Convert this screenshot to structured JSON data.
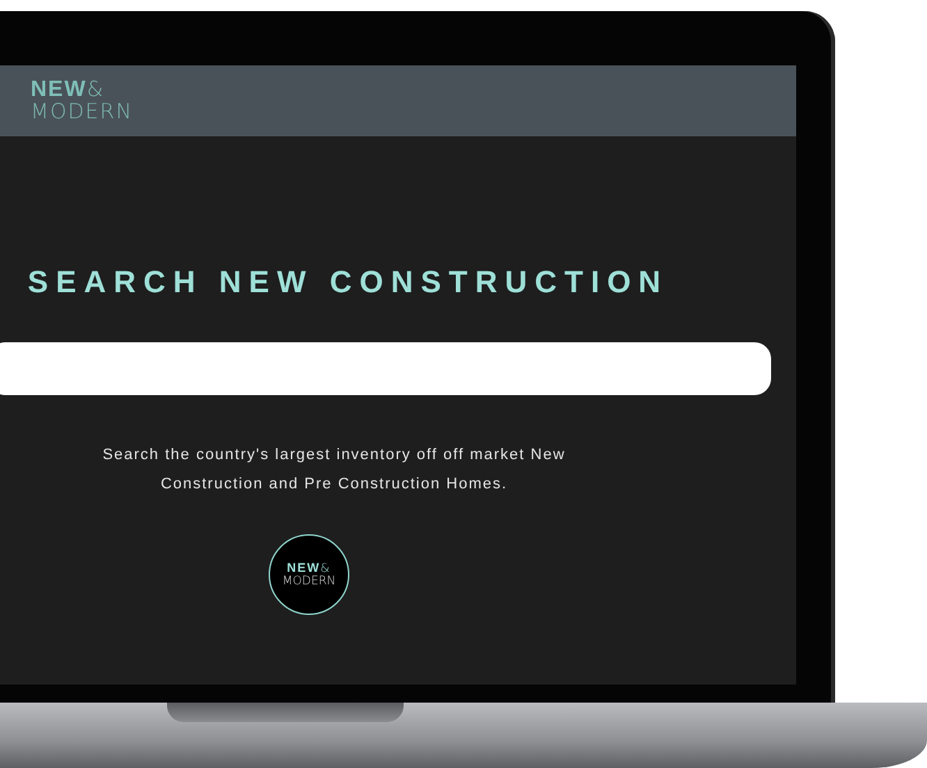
{
  "header": {
    "logo": {
      "word_1": "NEW",
      "symbol": "&",
      "word_2": "MODERN"
    }
  },
  "hero": {
    "title": "SEARCH NEW CONSTRUCTION",
    "description_lines": [
      "Search the country's largest inventory off off market New",
      "Construction and Pre Construction Homes."
    ]
  },
  "badge": {
    "word_1": "NEW",
    "symbol": "&",
    "word_2": "MODERN"
  }
}
